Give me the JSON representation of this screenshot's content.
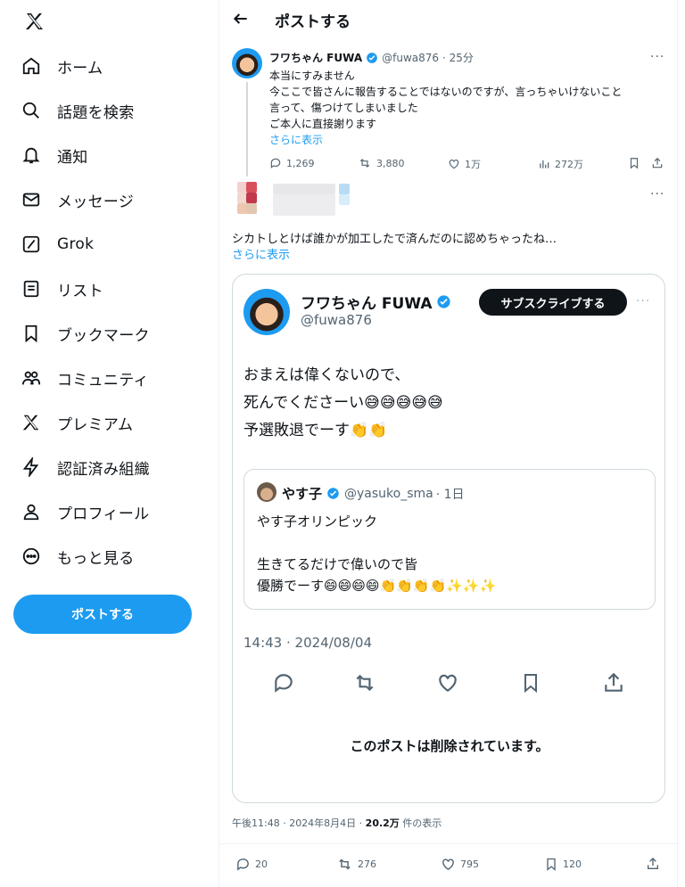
{
  "sidebar": {
    "logo_icon": "x-logo-icon",
    "items": [
      {
        "label": "ホーム",
        "icon": "home-icon"
      },
      {
        "label": "話題を検索",
        "icon": "search-icon"
      },
      {
        "label": "通知",
        "icon": "bell-icon"
      },
      {
        "label": "メッセージ",
        "icon": "mail-icon"
      },
      {
        "label": "Grok",
        "icon": "grok-icon"
      },
      {
        "label": "リスト",
        "icon": "list-icon"
      },
      {
        "label": "ブックマーク",
        "icon": "bookmark-icon"
      },
      {
        "label": "コミュニティ",
        "icon": "community-icon"
      },
      {
        "label": "プレミアム",
        "icon": "x-premium-icon"
      },
      {
        "label": "認証済み組織",
        "icon": "lightning-icon"
      },
      {
        "label": "プロフィール",
        "icon": "person-icon"
      },
      {
        "label": "もっと見る",
        "icon": "more-circle-icon"
      }
    ],
    "post_button": "ポストする"
  },
  "header": {
    "title": "ポストする"
  },
  "parent_post": {
    "name": "フワちゃん FUWA",
    "handle": "@fuwa876",
    "time": "· 25分",
    "lines": [
      "本当にすみません",
      "今ここで皆さんに報告することではないのですが、言っちゃいけないこと",
      "言って、傷つけてしまいました",
      "ご本人に直接謝ります"
    ],
    "show_more": "さらに表示",
    "stats": {
      "replies": "1,269",
      "reposts": "3,880",
      "likes": "1万",
      "views": "272万"
    }
  },
  "reply_post": {
    "text": "シカトしとけば誰かが加工したで済んだのに認めちゃったね…",
    "show_more": "さらに表示"
  },
  "embedded_post": {
    "name": "フワちゃん FUWA",
    "handle": "@fuwa876",
    "subscribe": "サブスクライブする",
    "lines": [
      "おまえは偉くないので、",
      "死んでくださーい😅😅😅😅😅",
      "予選敗退でーす👏👏"
    ],
    "quote": {
      "name": "やす子",
      "handle": "@yasuko_sma",
      "time": "· 1日",
      "line1": "やす子オリンピック",
      "line2": "生きてるだけで偉いので皆",
      "line3": "優勝でーす😄😄😄😄👏👏👏👏✨✨✨"
    },
    "timestamp": "14:43 · 2024/08/04",
    "deleted_notice": "このポストは削除されています。"
  },
  "reply_footer": {
    "time_text": "午後11:48 · 2024年8月4日 · ",
    "views": "20.2万",
    "views_suffix": " 件の表示",
    "stats": {
      "replies": "20",
      "reposts": "276",
      "likes": "795",
      "bookmarks": "120"
    }
  },
  "colors": {
    "accent": "#1d9bf0",
    "text": "#0f1419",
    "muted": "#536471"
  }
}
